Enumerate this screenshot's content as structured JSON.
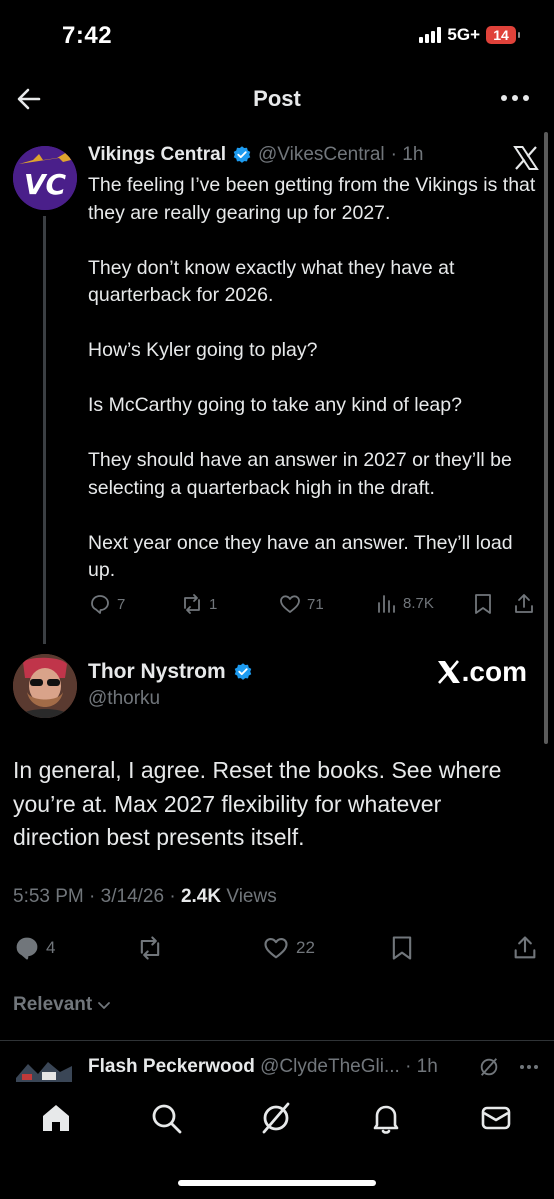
{
  "status_bar": {
    "time": "7:42",
    "network": "5G+",
    "battery": "14"
  },
  "header": {
    "title": "Post",
    "back_icon": "arrow-left-icon",
    "more_icon": "more-horizontal-icon"
  },
  "parent_tweet": {
    "name": "Vikings Central",
    "handle": "@VikesCentral",
    "time": "· 1h",
    "avatar_text": "VC",
    "paragraphs": [
      "The feeling I’ve been getting from the Vikings is that they are really gearing up for 2027.",
      "They don’t know exactly what they have at quarterback for 2026.",
      "How’s Kyler going to play?",
      "Is McCarthy going to take any kind of leap?",
      "They should have an answer in 2027 or they’ll be selecting a quarterback high in the draft.",
      "Next year once they have an answer. They’ll load up."
    ],
    "replies": "7",
    "reposts": "1",
    "likes": "71",
    "views": "8.7K"
  },
  "main_tweet": {
    "name": "Thor Nystrom",
    "handle": "@thorku",
    "watermark": ".com",
    "text": "In general, I agree. Reset the books. See where you’re at. Max 2027 flexibility for whatever direction best presents itself.",
    "time": "5:53 PM",
    "date": "3/14/26",
    "views_count": "2.4K",
    "views_label": "Views",
    "replies": "4",
    "likes": "22"
  },
  "sort": {
    "label": "Relevant"
  },
  "next_reply": {
    "name": "Flash Peckerwood",
    "handle": "@ClydeTheGli...",
    "time": "· 1h"
  },
  "colors": {
    "background": "#000000",
    "text": "#e7e9ea",
    "muted": "#71767b",
    "verified": "#1d9bf0",
    "battery": "#e0423a"
  }
}
